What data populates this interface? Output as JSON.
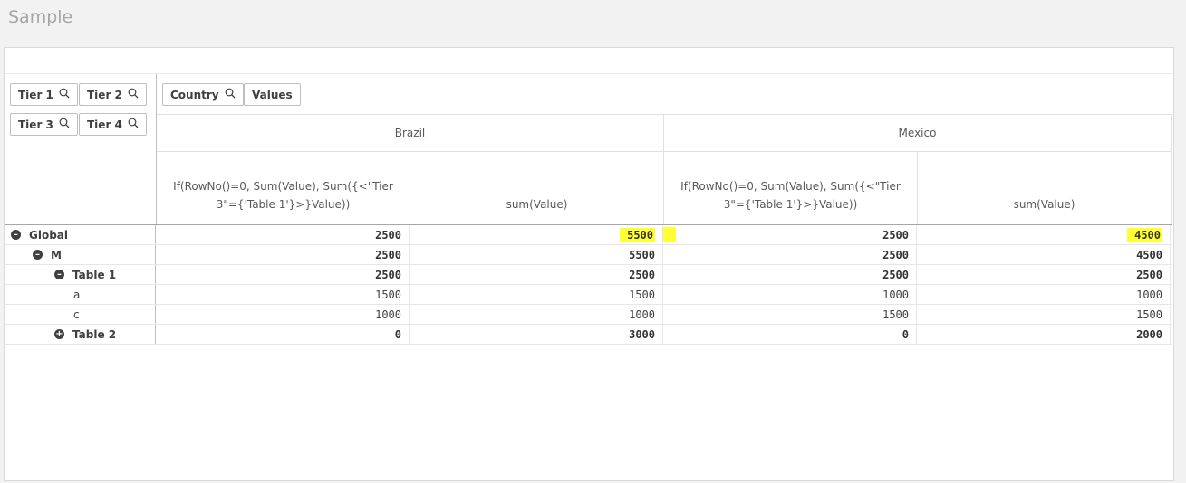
{
  "app": {
    "title": "Sample"
  },
  "dimension_chips": [
    {
      "label": "Tier 1",
      "icon": "search-icon"
    },
    {
      "label": "Tier 2",
      "icon": "search-icon"
    },
    {
      "label": "Tier 3",
      "icon": "search-icon"
    },
    {
      "label": "Tier 4",
      "icon": "search-icon"
    }
  ],
  "column_chips": [
    {
      "label": "Country",
      "icon": "search-icon"
    },
    {
      "label": "Values"
    }
  ],
  "countries": [
    "Brazil",
    "Mexico"
  ],
  "measures": [
    "If(RowNo()=0, Sum(Value), Sum({<\"Tier 3\"={'Table 1'}>}Value))",
    "sum(Value)"
  ],
  "rows": [
    {
      "label": "Global",
      "toggle": "collapse",
      "bold": true,
      "values": [
        "2500",
        "5500",
        "2500",
        "4500"
      ],
      "highlighted": [
        false,
        true,
        false,
        true
      ]
    },
    {
      "label": "M",
      "toggle": "collapse",
      "bold": true,
      "values": [
        "2500",
        "5500",
        "2500",
        "4500"
      ]
    },
    {
      "label": "Table 1",
      "toggle": "collapse",
      "bold": true,
      "values": [
        "2500",
        "2500",
        "2500",
        "2500"
      ]
    },
    {
      "label": "a",
      "toggle": null,
      "bold": false,
      "values": [
        "1500",
        "1500",
        "1000",
        "1000"
      ]
    },
    {
      "label": "c",
      "toggle": null,
      "bold": false,
      "values": [
        "1000",
        "1000",
        "1500",
        "1500"
      ]
    },
    {
      "label": "Table 2",
      "toggle": "expand",
      "bold": true,
      "values": [
        "0",
        "3000",
        "0",
        "2000"
      ]
    }
  ],
  "colors": {
    "highlight": "#ffff33",
    "title": "#a6a6a6",
    "border": "#bfbfbf"
  }
}
